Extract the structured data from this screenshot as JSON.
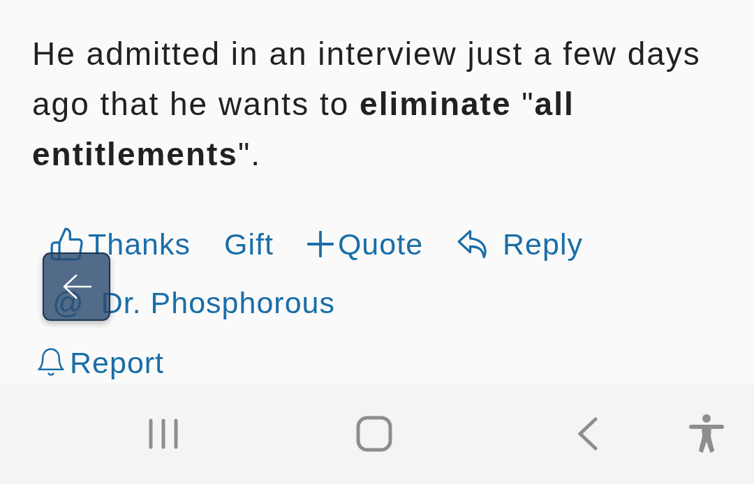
{
  "post": {
    "text": "He admitted in an interview just a few days ago that he wants to **eliminate** \"**all entitlements**\"."
  },
  "actions": [
    {
      "kind": "thanks",
      "label": "Thanks"
    },
    {
      "kind": "gift",
      "label": "Gift"
    },
    {
      "kind": "quote",
      "label": "Quote"
    },
    {
      "kind": "reply",
      "label": "Reply"
    }
  ],
  "mention": {
    "symbol": "@",
    "name": "Dr. Phosphorous"
  },
  "report": {
    "label": "Report"
  }
}
